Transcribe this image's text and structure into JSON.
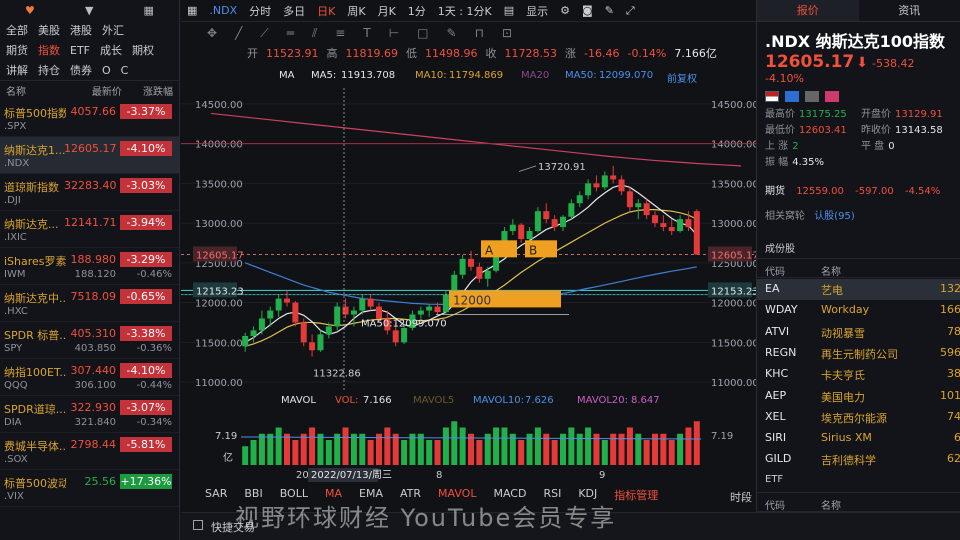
{
  "watch_tabs": [
    "全部",
    "美股",
    "港股",
    "外汇"
  ],
  "watch_tabs2": [
    "期货",
    "指数",
    "ETF",
    "成长",
    "期权"
  ],
  "watch_tabs3": [
    "讲解",
    "持仓",
    "债券",
    "O",
    "C"
  ],
  "watch_head": {
    "name": "名称",
    "price": "最新价",
    "chg": "涨跌幅"
  },
  "watchlist": [
    {
      "name": "标普500指数",
      "sym": ".SPX",
      "price": "4057.66",
      "p2": "",
      "chg": "-3.37%",
      "c2": "",
      "color": "red"
    },
    {
      "name": "纳斯达克1...",
      "sym": ".NDX",
      "price": "12605.17",
      "p2": "",
      "chg": "-4.10%",
      "c2": "",
      "color": "red"
    },
    {
      "name": "道琼斯指数",
      "sym": ".DJI",
      "price": "32283.40",
      "p2": "",
      "chg": "-3.03%",
      "c2": "",
      "color": "red"
    },
    {
      "name": "纳斯达克...",
      "sym": ".IXIC",
      "price": "12141.71",
      "p2": "",
      "chg": "-3.94%",
      "c2": "",
      "color": "red"
    },
    {
      "name": "iShares罗素...",
      "sym": "IWM",
      "price": "188.980",
      "p2": "188.120",
      "chg": "-3.29%",
      "c2": "-0.46%",
      "color": "red"
    },
    {
      "name": "纳斯达克中...",
      "sym": ".HXC",
      "price": "7518.09",
      "p2": "",
      "chg": "-0.65%",
      "c2": "",
      "color": "red"
    },
    {
      "name": "SPDR 标普...",
      "sym": "SPY",
      "price": "405.310",
      "p2": "403.850",
      "chg": "-3.38%",
      "c2": "-0.36%",
      "color": "red"
    },
    {
      "name": "纳指100ET...",
      "sym": "QQQ",
      "price": "307.440",
      "p2": "306.100",
      "chg": "-4.10%",
      "c2": "-0.44%",
      "color": "red"
    },
    {
      "name": "SPDR道琼...",
      "sym": "DIA",
      "price": "322.930",
      "p2": "321.840",
      "chg": "-3.07%",
      "c2": "-0.34%",
      "color": "red"
    },
    {
      "name": "费城半导体...",
      "sym": ".SOX",
      "price": "2798.44",
      "p2": "",
      "chg": "-5.81%",
      "c2": "",
      "color": "red"
    },
    {
      "name": "标普500波动...",
      "sym": ".VIX",
      "price": "25.56",
      "p2": "",
      "chg": "+17.36%",
      "c2": "",
      "color": "grn"
    }
  ],
  "topbar": {
    "sym": ".NDX",
    "items": [
      "分时",
      "多日",
      "日K",
      "周K",
      "月K",
      "1分",
      "1天 : 1分K"
    ],
    "active": "日K",
    "display": "显示"
  },
  "ohlc": {
    "o_lab": "开",
    "o": "11523.91",
    "h_lab": "高",
    "h": "11819.69",
    "l_lab": "低",
    "l": "11498.96",
    "c_lab": "收",
    "c": "11728.53",
    "chg_lab": "涨",
    "chg": "-16.46",
    "pct": "-0.14%",
    "amt": "7.166亿"
  },
  "ma_row": {
    "ma": "MA",
    "ma5_lab": "MA5:",
    "ma5": "11913.708",
    "ma10_lab": "MA10:",
    "ma10": "11794.869",
    "ma20": "MA20",
    "ma50_lab": "MA50:",
    "ma50": "12099.070",
    "adj": "前复权"
  },
  "chart_data": {
    "type": "candlestick",
    "ylim": [
      10900,
      14700
    ],
    "y_ticks": [
      14500,
      14000,
      13500,
      13000,
      12500,
      12000,
      11500,
      11000
    ],
    "y_tick_labels": [
      "14500.00",
      "14000.00",
      "13500.00",
      "13000.00",
      "12500.00",
      "12000.00",
      "11500.00",
      "11000.00"
    ],
    "candles": [
      {
        "o": 11450,
        "h": 11620,
        "l": 11380,
        "c": 11580
      },
      {
        "o": 11580,
        "h": 11700,
        "l": 11500,
        "c": 11650
      },
      {
        "o": 11650,
        "h": 11900,
        "l": 11600,
        "c": 11800
      },
      {
        "o": 11800,
        "h": 11950,
        "l": 11700,
        "c": 11900
      },
      {
        "o": 11900,
        "h": 12100,
        "l": 11820,
        "c": 12050
      },
      {
        "o": 12050,
        "h": 12150,
        "l": 11950,
        "c": 12000
      },
      {
        "o": 12000,
        "h": 12020,
        "l": 11700,
        "c": 11750
      },
      {
        "o": 11750,
        "h": 11800,
        "l": 11450,
        "c": 11500
      },
      {
        "o": 11500,
        "h": 11600,
        "l": 11322,
        "c": 11400
      },
      {
        "o": 11400,
        "h": 11650,
        "l": 11380,
        "c": 11600
      },
      {
        "o": 11600,
        "h": 11750,
        "l": 11550,
        "c": 11700
      },
      {
        "o": 11700,
        "h": 12000,
        "l": 11650,
        "c": 11950
      },
      {
        "o": 11950,
        "h": 12050,
        "l": 11800,
        "c": 11850
      },
      {
        "o": 11850,
        "h": 11950,
        "l": 11700,
        "c": 11900
      },
      {
        "o": 11900,
        "h": 12100,
        "l": 11850,
        "c": 12050
      },
      {
        "o": 12050,
        "h": 12100,
        "l": 11900,
        "c": 11950
      },
      {
        "o": 11950,
        "h": 12000,
        "l": 11750,
        "c": 11800
      },
      {
        "o": 11800,
        "h": 11900,
        "l": 11600,
        "c": 11650
      },
      {
        "o": 11650,
        "h": 11750,
        "l": 11450,
        "c": 11500
      },
      {
        "o": 11500,
        "h": 11700,
        "l": 11480,
        "c": 11680
      },
      {
        "o": 11680,
        "h": 11900,
        "l": 11650,
        "c": 11850
      },
      {
        "o": 11850,
        "h": 11950,
        "l": 11800,
        "c": 11900
      },
      {
        "o": 11900,
        "h": 11980,
        "l": 11820,
        "c": 11950
      },
      {
        "o": 11950,
        "h": 12000,
        "l": 11850,
        "c": 11880
      },
      {
        "o": 11880,
        "h": 12150,
        "l": 11860,
        "c": 12100
      },
      {
        "o": 12100,
        "h": 12400,
        "l": 12080,
        "c": 12350
      },
      {
        "o": 12350,
        "h": 12600,
        "l": 12300,
        "c": 12550
      },
      {
        "o": 12550,
        "h": 12650,
        "l": 12400,
        "c": 12450
      },
      {
        "o": 12450,
        "h": 12500,
        "l": 12250,
        "c": 12300
      },
      {
        "o": 12300,
        "h": 12450,
        "l": 12200,
        "c": 12400
      },
      {
        "o": 12400,
        "h": 12700,
        "l": 12380,
        "c": 12650
      },
      {
        "o": 12650,
        "h": 12950,
        "l": 12600,
        "c": 12900
      },
      {
        "o": 12900,
        "h": 13050,
        "l": 12850,
        "c": 12980
      },
      {
        "o": 12980,
        "h": 13000,
        "l": 12750,
        "c": 12800
      },
      {
        "o": 12800,
        "h": 12950,
        "l": 12700,
        "c": 12900
      },
      {
        "o": 12900,
        "h": 13200,
        "l": 12880,
        "c": 13150
      },
      {
        "o": 13150,
        "h": 13250,
        "l": 13000,
        "c": 13050
      },
      {
        "o": 13050,
        "h": 13100,
        "l": 12900,
        "c": 12950
      },
      {
        "o": 12950,
        "h": 13100,
        "l": 12900,
        "c": 13080
      },
      {
        "o": 13080,
        "h": 13300,
        "l": 13050,
        "c": 13250
      },
      {
        "o": 13250,
        "h": 13400,
        "l": 13200,
        "c": 13350
      },
      {
        "o": 13350,
        "h": 13550,
        "l": 13300,
        "c": 13500
      },
      {
        "o": 13500,
        "h": 13600,
        "l": 13400,
        "c": 13450
      },
      {
        "o": 13450,
        "h": 13650,
        "l": 13420,
        "c": 13600
      },
      {
        "o": 13600,
        "h": 13720,
        "l": 13500,
        "c": 13550
      },
      {
        "o": 13550,
        "h": 13600,
        "l": 13350,
        "c": 13400
      },
      {
        "o": 13400,
        "h": 13450,
        "l": 13150,
        "c": 13200
      },
      {
        "o": 13200,
        "h": 13300,
        "l": 13050,
        "c": 13250
      },
      {
        "o": 13250,
        "h": 13300,
        "l": 13050,
        "c": 13100
      },
      {
        "o": 13100,
        "h": 13150,
        "l": 12950,
        "c": 13000
      },
      {
        "o": 13000,
        "h": 13100,
        "l": 12900,
        "c": 12950
      },
      {
        "o": 12950,
        "h": 13050,
        "l": 12850,
        "c": 12900
      },
      {
        "o": 12900,
        "h": 13100,
        "l": 12880,
        "c": 13050
      },
      {
        "o": 13050,
        "h": 13150,
        "l": 12900,
        "c": 12950
      },
      {
        "o": 13150,
        "h": 13175,
        "l": 12603,
        "c": 12605
      }
    ],
    "ma5": [
      11500,
      11560,
      11640,
      11720,
      11800,
      11860,
      11880,
      11840,
      11760,
      11650,
      11600,
      11630,
      11700,
      11800,
      11880,
      11900,
      11910,
      11880,
      11800,
      11720,
      11700,
      11740,
      11780,
      11830,
      11880,
      11980,
      12120,
      12260,
      12360,
      12420,
      12480,
      12550,
      12640,
      12720,
      12780,
      12850,
      12920,
      12960,
      13000,
      13050,
      13120,
      13200,
      13300,
      13380,
      13450,
      13480,
      13450,
      13380,
      13300,
      13220,
      13140,
      13060,
      13000,
      12970,
      12850
    ],
    "ma10": [
      11450,
      11480,
      11520,
      11570,
      11630,
      11690,
      11730,
      11750,
      11750,
      11740,
      11720,
      11710,
      11720,
      11740,
      11760,
      11780,
      11790,
      11800,
      11800,
      11790,
      11780,
      11770,
      11780,
      11790,
      11810,
      11850,
      11900,
      11960,
      12020,
      12080,
      12150,
      12220,
      12300,
      12380,
      12450,
      12520,
      12580,
      12640,
      12700,
      12760,
      12820,
      12880,
      12940,
      13000,
      13050,
      13100,
      13140,
      13160,
      13170,
      13170,
      13160,
      13150,
      13130,
      13100,
      13050
    ],
    "ma50": [
      12500,
      12460,
      12420,
      12380,
      12340,
      12300,
      12260,
      12220,
      12190,
      12160,
      12130,
      12110,
      12090,
      12070,
      12050,
      12040,
      12030,
      12020,
      12010,
      12000,
      11990,
      11985,
      11980,
      11978,
      11976,
      11975,
      11976,
      11978,
      11982,
      11988,
      11995,
      12005,
      12015,
      12028,
      12042,
      12058,
      12076,
      12095,
      12115,
      12135,
      12158,
      12180,
      12200,
      12222,
      12244,
      12266,
      12290,
      12312,
      12335,
      12355,
      12375,
      12395,
      12412,
      12430,
      12450
    ],
    "ma_long": [
      14380,
      14350,
      14320,
      14290,
      14260,
      14230,
      14200,
      14170,
      14140,
      14110,
      14080,
      14050,
      14020,
      13990,
      13960,
      13930,
      13900,
      13870,
      13840,
      13815,
      13790,
      13770,
      13750,
      13735,
      13720
    ],
    "annot_high": "13720.91",
    "annot_low": "11322.86",
    "ma50_label": "MA50:12099.070",
    "box_a": "A",
    "box_b": "B",
    "box_12000": "12000",
    "hline_left": "12605.17",
    "hline_right": "12605.17",
    "hline2_left": "12153.23",
    "hline2_right": "12153.23",
    "cursor_date": "2022/07/13/周三",
    "x_labels": [
      "20",
      "8",
      "9"
    ],
    "vol": [
      3,
      4,
      5,
      5,
      6,
      5,
      4,
      5,
      6,
      5,
      4,
      5,
      6,
      5,
      5,
      4,
      5,
      6,
      5,
      4,
      5,
      5,
      4,
      4,
      6,
      7,
      6,
      5,
      4,
      5,
      6,
      6,
      5,
      4,
      5,
      6,
      5,
      4,
      5,
      6,
      5,
      6,
      5,
      4,
      5,
      5,
      6,
      5,
      4,
      5,
      5,
      4,
      5,
      6,
      7
    ],
    "vol_labels": {
      "top": "7.19",
      "unit": "亿"
    }
  },
  "mavol_row": {
    "mavol": "MAVOL",
    "vol_lab": "VOL:",
    "vol": "7.166",
    "mavol5": "MAVOL5",
    "mavol10_lab": "MAVOL10:",
    "mavol10": "7.626",
    "mavol20_lab": "MAVOL20:",
    "mavol20": "8.647"
  },
  "indicators": [
    "SAR",
    "BBI",
    "BOLL",
    "MA",
    "EMA",
    "ATR",
    "MAVOL",
    "MACD",
    "RSI",
    "KDJ",
    "指标管理"
  ],
  "ind_active": [
    "MA",
    "MAVOL"
  ],
  "timeframe": "时段",
  "footer": {
    "quick": "快捷交易"
  },
  "watermark": "视野环球财经 YouTube会员专享",
  "right": {
    "tab1": "报价",
    "tab2": "资讯",
    "title": ".NDX  纳斯达克100指数",
    "price": "12605.17",
    "chg": "-538.42 -4.10%",
    "kv": [
      {
        "l": "最高价",
        "v": "13175.25",
        "c": "grn",
        "x": 8,
        "y": 105
      },
      {
        "l": "开盘价",
        "v": "13129.91",
        "c": "red",
        "x": 104,
        "y": 105
      },
      {
        "l": "最低价",
        "v": "12603.41",
        "c": "red",
        "x": 8,
        "y": 121
      },
      {
        "l": "昨收价",
        "v": "13143.58",
        "c": "wht",
        "x": 104,
        "y": 121
      },
      {
        "l": "上 涨",
        "v": "2",
        "c": "grn",
        "x": 8,
        "y": 137
      },
      {
        "l": "平 盘",
        "v": "0",
        "c": "wht",
        "x": 104,
        "y": 137
      },
      {
        "l": "振 幅",
        "v": "4.35%",
        "c": "wht",
        "x": 8,
        "y": 153
      }
    ],
    "futures": {
      "l": "期货",
      "v": "12559.00",
      "chg": "-597.00",
      "pct": "-4.54%"
    },
    "related": {
      "l": "相关窝轮",
      "v": "认股(95)"
    },
    "cons_title": "成份股",
    "cons_head": {
      "code": "代码",
      "name": "名称"
    },
    "constituents": [
      {
        "code": "EA",
        "name": "艺电",
        "val": "132"
      },
      {
        "code": "WDAY",
        "name": "Workday",
        "val": "166"
      },
      {
        "code": "ATVI",
        "name": "动视暴雪",
        "val": "78"
      },
      {
        "code": "REGN",
        "name": "再生元制药公司",
        "val": "596"
      },
      {
        "code": "KHC",
        "name": "卡夫亨氏",
        "val": "38"
      },
      {
        "code": "AEP",
        "name": "美国电力",
        "val": "101"
      },
      {
        "code": "XEL",
        "name": "埃克西尔能源",
        "val": "74"
      },
      {
        "code": "SIRI",
        "name": "Sirius XM",
        "val": "6"
      },
      {
        "code": "GILD",
        "name": "吉利德科学",
        "val": "62"
      }
    ],
    "etf_title": "ETF",
    "etf_head": {
      "code": "代码",
      "name": "名称"
    }
  }
}
